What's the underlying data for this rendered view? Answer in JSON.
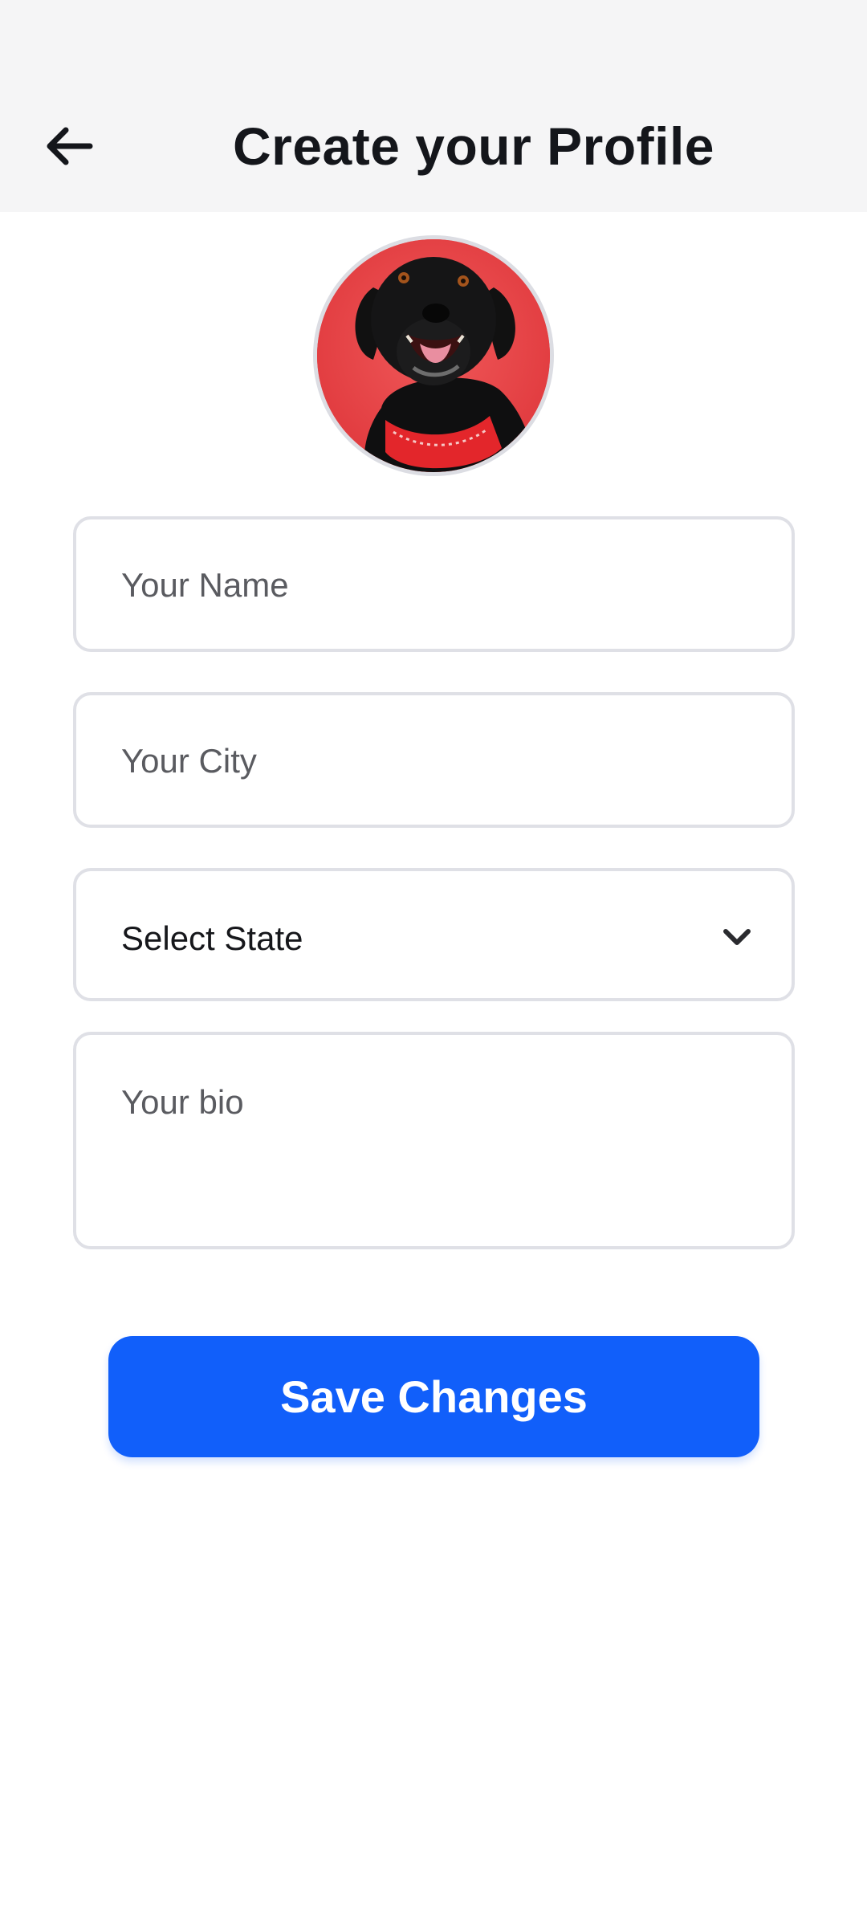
{
  "header": {
    "title": "Create your Profile",
    "back_icon": "arrow-left-icon",
    "background": "#f5f5f6"
  },
  "avatar": {
    "description_icon": "dog-avatar",
    "background": "#e94c4e"
  },
  "form": {
    "name_placeholder": "Your Name",
    "city_placeholder": "Your City",
    "state_selected": "Select State",
    "state_icon": "chevron-down-icon",
    "bio_placeholder": "Your bio"
  },
  "actions": {
    "save_label": "Save Changes",
    "accent": "#115ffa"
  }
}
